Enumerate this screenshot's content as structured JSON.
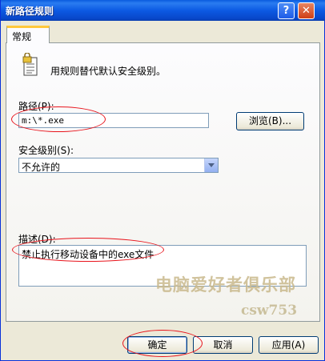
{
  "window": {
    "title": "新路径规则"
  },
  "titlebar": {
    "help_glyph": "?",
    "close_glyph": "✕"
  },
  "tabs": [
    {
      "label": "常规"
    }
  ],
  "intro": {
    "text": "用规则替代默认安全级别。"
  },
  "path": {
    "label": "路径(P):",
    "value": "m:\\*.exe",
    "browse_label": "浏览(B)..."
  },
  "security_level": {
    "label": "安全级别(S):",
    "selected": "不允许的"
  },
  "description": {
    "label": "描述(D):",
    "value": "禁止执行移动设备中的exe文件"
  },
  "watermark": {
    "line1": "电脑爱好者俱乐部",
    "line2": "csw753"
  },
  "buttons": {
    "ok": "确定",
    "cancel": "取消",
    "apply": "应用(A)"
  },
  "colors": {
    "title_bar": "#0c5ae3",
    "annotation": "#e8141c",
    "dialog_bg": "#ece9d8"
  }
}
